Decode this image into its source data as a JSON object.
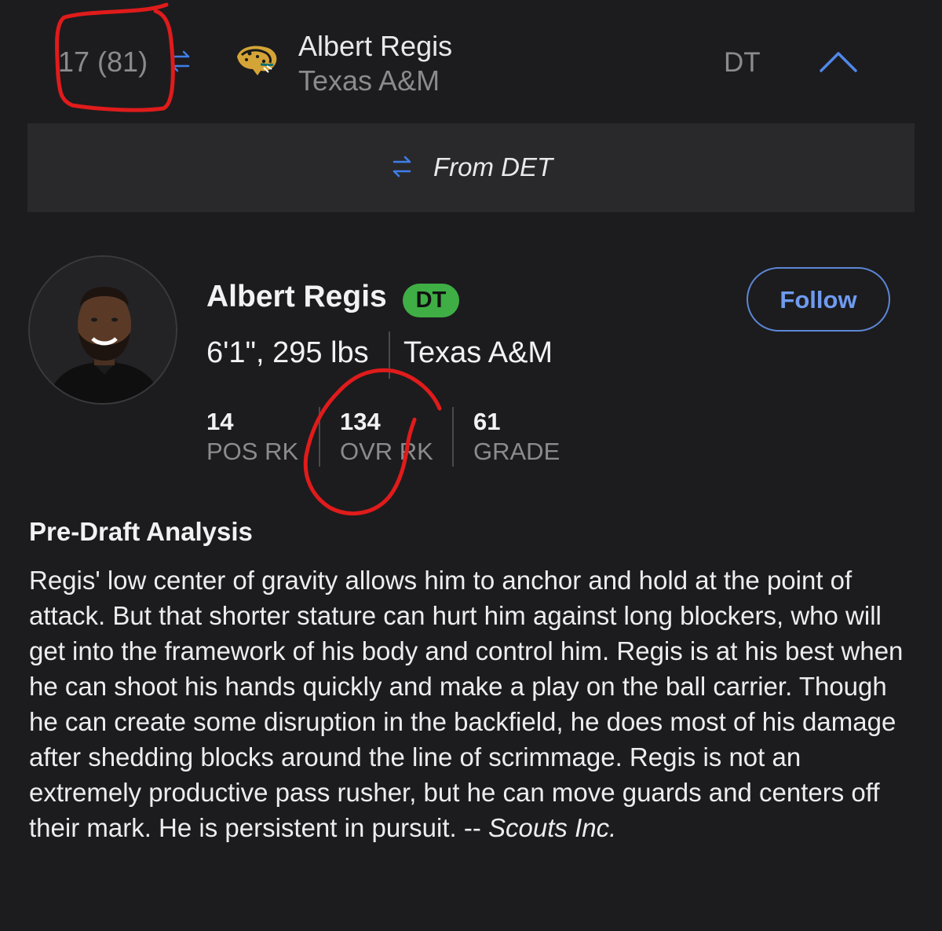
{
  "header": {
    "pick": "17 (81)",
    "player_name": "Albert Regis",
    "school": "Texas A&M",
    "position": "DT",
    "team_logo": "jaguars-logo",
    "trade_icon": "swap-arrows-icon",
    "collapse_icon": "chevron-up-icon"
  },
  "trade": {
    "text": "From DET"
  },
  "profile": {
    "name": "Albert Regis",
    "position_badge": "DT",
    "follow_label": "Follow",
    "height_weight": "6'1\", 295 lbs",
    "school": "Texas A&M",
    "stats": [
      {
        "value": "14",
        "label": "POS RK"
      },
      {
        "value": "134",
        "label": "OVR RK"
      },
      {
        "value": "61",
        "label": "GRADE"
      }
    ]
  },
  "analysis": {
    "title": "Pre-Draft Analysis",
    "body": "Regis' low center of gravity allows him to anchor and hold at the point of attack. But that shorter stature can hurt him against long blockers, who will get into the framework of his body and control him. Regis is at his best when he can shoot his hands quickly and make a play on the ball carrier. Though he can create some disruption in the backfield, he does most of his damage after shedding blocks around the line of scrimmage. Regis is not an extremely productive pass rusher, but he can move guards and centers off their mark. He is persistent in pursuit. -- ",
    "credit": "Scouts Inc."
  },
  "colors": {
    "background": "#1c1c1e",
    "panel": "#29292c",
    "accent_blue": "#5d86d6",
    "badge_green": "#3fae45",
    "annotation_red": "#e01b1b"
  }
}
